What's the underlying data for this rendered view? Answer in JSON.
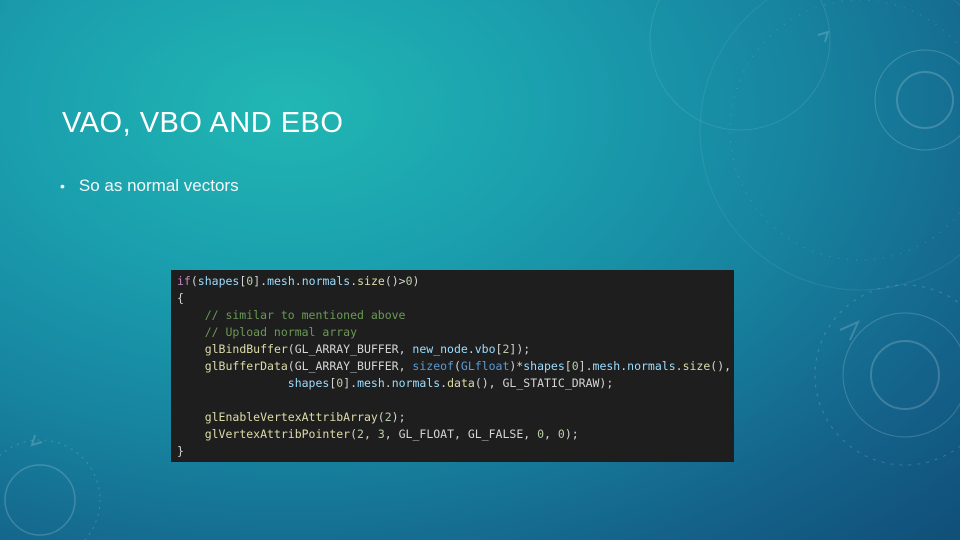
{
  "slide": {
    "title": "VAO, VBO AND EBO",
    "bullets": [
      "So as normal vectors"
    ]
  },
  "code": {
    "lines": [
      "if(shapes[0].mesh.normals.size()>0)",
      "{",
      "    // similar to mentioned above",
      "    // Upload normal array",
      "    glBindBuffer(GL_ARRAY_BUFFER, new_node.vbo[2]);",
      "    glBufferData(GL_ARRAY_BUFFER, sizeof(GLfloat)*shapes[0].mesh.normals.size(),",
      "                shapes[0].mesh.normals.data(), GL_STATIC_DRAW);",
      "",
      "    glEnableVertexAttribArray(2);",
      "    glVertexAttribPointer(2, 3, GL_FLOAT, GL_FALSE, 0, 0);",
      "}"
    ]
  },
  "colors": {
    "background_top": "#21b7b3",
    "background_bottom": "#104f78",
    "code_background": "#1e1e1e"
  }
}
